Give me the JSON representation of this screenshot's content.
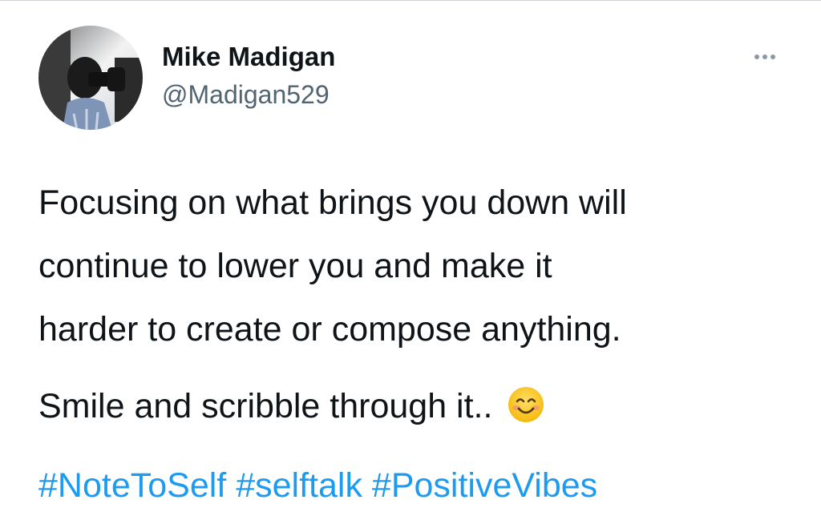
{
  "author": {
    "name": "Mike Madigan",
    "handle": "@Madigan529",
    "avatar_icon": "profile-photo"
  },
  "menu": {
    "icon": "more-horizontal-icon"
  },
  "tweet": {
    "lines_para1": [
      "Focusing on what brings you down will",
      "continue to lower you and make it",
      "harder to create or compose anything."
    ],
    "para2": "Smile and scribble through it..",
    "emoji": "smiling-face-emoji"
  },
  "hashtags": [
    "#NoteToSelf",
    "#selftalk",
    "#PositiveVibes"
  ],
  "colors": {
    "text": "#0f1419",
    "secondary": "#536471",
    "link": "#1d9bf0"
  }
}
